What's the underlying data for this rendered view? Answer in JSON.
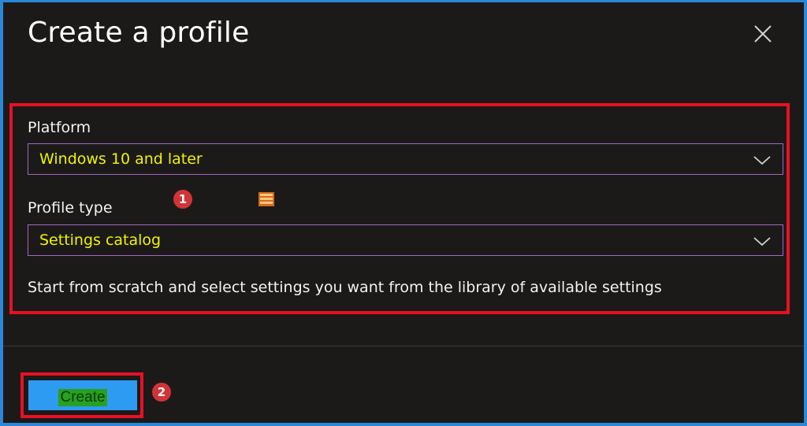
{
  "dialog": {
    "title": "Create a profile",
    "close_icon": "close-icon"
  },
  "platform": {
    "label": "Platform",
    "value": "Windows 10 and later"
  },
  "profile_type": {
    "label": "Profile type",
    "value": "Settings catalog",
    "description": "Start from scratch and select settings you want from the library of available settings"
  },
  "annotations": {
    "step1": "1",
    "step2": "2"
  },
  "footer": {
    "create_label": "Create"
  },
  "colors": {
    "panel_bg": "#1b1a19",
    "border_blue": "#2b88d8",
    "highlight_red": "#e81123",
    "select_border": "#a367c4",
    "highlight_yellow": "#f2f200",
    "button_blue": "#2e9bf2"
  }
}
